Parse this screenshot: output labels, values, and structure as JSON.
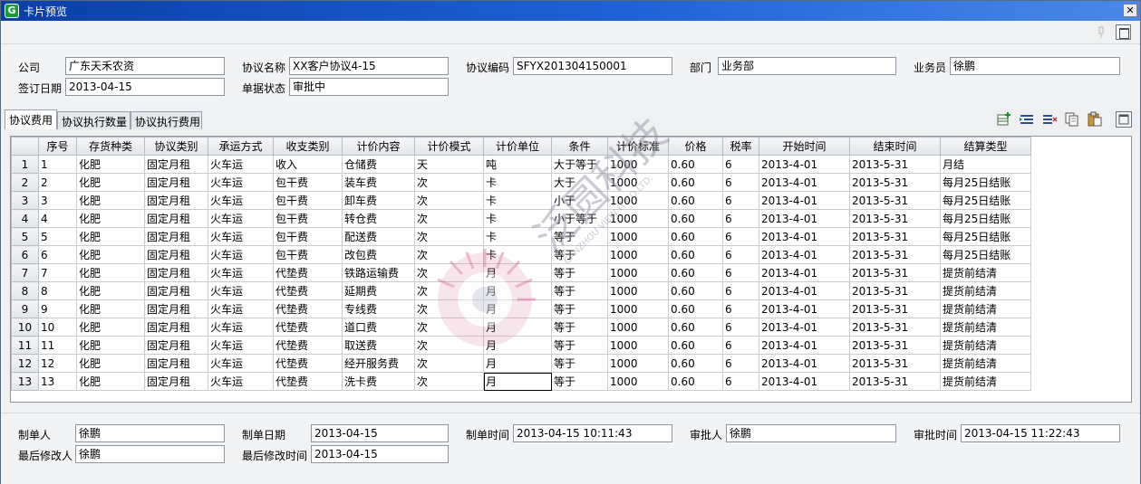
{
  "window": {
    "title": "卡片预览",
    "close_glyph": "✕",
    "app_glyph": "G"
  },
  "header": {
    "company_label": "公司",
    "company_value": "广东天禾农资",
    "agreement_name_label": "协议名称",
    "agreement_name_value": "XX客户协议4-15",
    "agreement_code_label": "协议编码",
    "agreement_code_value": "SFYX201304150001",
    "department_label": "部门",
    "department_value": "业务部",
    "salesman_label": "业务员",
    "salesman_value": "徐鹏",
    "sign_date_label": "签订日期",
    "sign_date_value": "2013-04-15",
    "doc_status_label": "单据状态",
    "doc_status_value": "审批中"
  },
  "tabs": [
    {
      "label": "协议费用"
    },
    {
      "label": "协议执行数量"
    },
    {
      "label": "协议执行费用"
    }
  ],
  "toolbar_icons": [
    "add-row-icon",
    "insert-row-icon",
    "delete-row-icon",
    "copy-icon",
    "paste-icon",
    "maximize-icon"
  ],
  "grid": {
    "columns": [
      "序号",
      "存货种类",
      "协议类别",
      "承运方式",
      "收支类别",
      "计价内容",
      "计价模式",
      "计价单位",
      "条件",
      "计价标准",
      "价格",
      "税率",
      "开始时间",
      "结束时间",
      "结算类型"
    ],
    "rows": [
      [
        "1",
        "1",
        "化肥",
        "固定月租",
        "火车运",
        "收入",
        "仓储费",
        "天",
        "吨",
        "大于等于",
        "1000",
        "0.60",
        "6",
        "2013-4-01",
        "2013-5-31",
        "月结"
      ],
      [
        "2",
        "2",
        "化肥",
        "固定月租",
        "火车运",
        "包干费",
        "装车费",
        "次",
        "卡",
        "大于",
        "1000",
        "0.60",
        "6",
        "2013-4-01",
        "2013-5-31",
        "每月25日结账"
      ],
      [
        "3",
        "3",
        "化肥",
        "固定月租",
        "火车运",
        "包干费",
        "卸车费",
        "次",
        "卡",
        "小于",
        "1000",
        "0.60",
        "6",
        "2013-4-01",
        "2013-5-31",
        "每月25日结账"
      ],
      [
        "4",
        "4",
        "化肥",
        "固定月租",
        "火车运",
        "包干费",
        "转仓费",
        "次",
        "卡",
        "小于等于",
        "1000",
        "0.60",
        "6",
        "2013-4-01",
        "2013-5-31",
        "每月25日结账"
      ],
      [
        "5",
        "5",
        "化肥",
        "固定月租",
        "火车运",
        "包干费",
        "配送费",
        "次",
        "卡",
        "等于",
        "1000",
        "0.60",
        "6",
        "2013-4-01",
        "2013-5-31",
        "每月25日结账"
      ],
      [
        "6",
        "6",
        "化肥",
        "固定月租",
        "火车运",
        "包干费",
        "改包费",
        "次",
        "卡",
        "等于",
        "1000",
        "0.60",
        "6",
        "2013-4-01",
        "2013-5-31",
        "每月25日结账"
      ],
      [
        "7",
        "7",
        "化肥",
        "固定月租",
        "火车运",
        "代垫费",
        "铁路运输费",
        "次",
        "月",
        "等于",
        "1000",
        "0.60",
        "6",
        "2013-4-01",
        "2013-5-31",
        "提货前结清"
      ],
      [
        "8",
        "8",
        "化肥",
        "固定月租",
        "火车运",
        "代垫费",
        "延期费",
        "次",
        "月",
        "等于",
        "1000",
        "0.60",
        "6",
        "2013-4-01",
        "2013-5-31",
        "提货前结清"
      ],
      [
        "9",
        "9",
        "化肥",
        "固定月租",
        "火车运",
        "代垫费",
        "专线费",
        "次",
        "月",
        "等于",
        "1000",
        "0.60",
        "6",
        "2013-4-01",
        "2013-5-31",
        "提货前结清"
      ],
      [
        "10",
        "10",
        "化肥",
        "固定月租",
        "火车运",
        "代垫费",
        "道口费",
        "次",
        "月",
        "等于",
        "1000",
        "0.60",
        "6",
        "2013-4-01",
        "2013-5-31",
        "提货前结清"
      ],
      [
        "11",
        "11",
        "化肥",
        "固定月租",
        "火车运",
        "代垫费",
        "取送费",
        "次",
        "月",
        "等于",
        "1000",
        "0.60",
        "6",
        "2013-4-01",
        "2013-5-31",
        "提货前结清"
      ],
      [
        "12",
        "12",
        "化肥",
        "固定月租",
        "火车运",
        "代垫费",
        "经开服务费",
        "次",
        "月",
        "等于",
        "1000",
        "0.60",
        "6",
        "2013-4-01",
        "2013-5-31",
        "提货前结清"
      ],
      [
        "13",
        "13",
        "化肥",
        "固定月租",
        "火车运",
        "代垫费",
        "洗卡费",
        "次",
        "月",
        "等于",
        "1000",
        "0.60",
        "6",
        "2013-4-01",
        "2013-5-31",
        "提货前结清"
      ]
    ]
  },
  "footer": {
    "creator_label": "制单人",
    "creator_value": "徐鹏",
    "create_date_label": "制单日期",
    "create_date_value": "2013-04-15",
    "create_time_label": "制单时间",
    "create_time_value": "2013-04-15 10:11:43",
    "approver_label": "审批人",
    "approver_value": "徐鹏",
    "approve_time_label": "审批时间",
    "approve_time_value": "2013-04-15 11:22:43",
    "last_modifier_label": "最后修改人",
    "last_modifier_value": "徐鹏",
    "last_modify_time_label": "最后修改时间",
    "last_modify_time_value": "2013-04-15"
  },
  "watermark": {
    "cn": "泛圆科技",
    "en": "CANZHOU VIEW IT CO.LTD."
  },
  "colors": {
    "titlebar": "#1f62d6",
    "panel": "#f2f3f5",
    "grid_border": "#c9cdd3"
  }
}
